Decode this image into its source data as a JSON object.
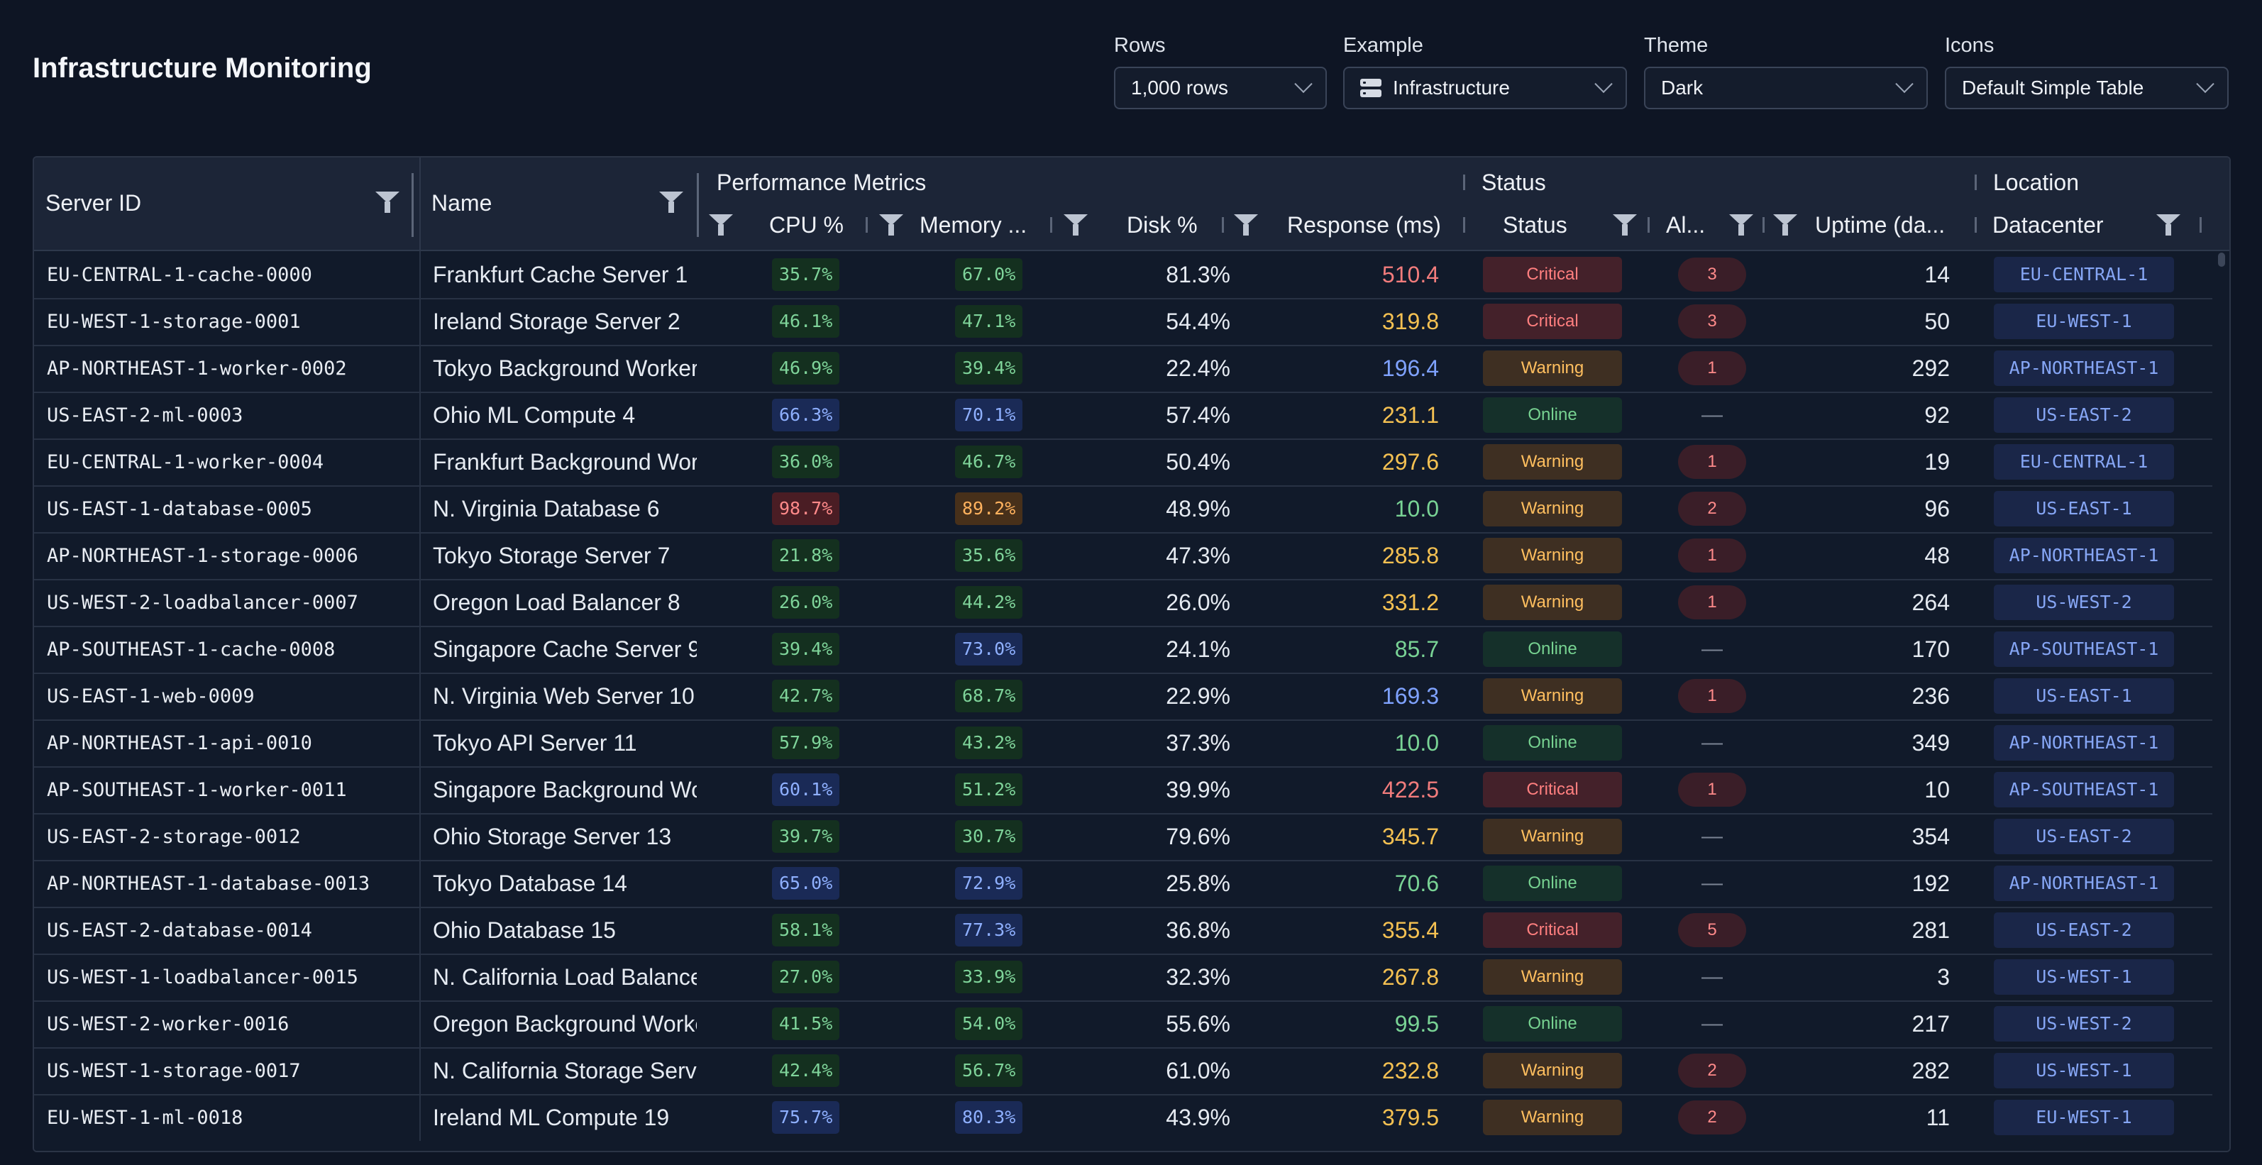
{
  "header": {
    "title": "Infrastructure Monitoring"
  },
  "controls": [
    {
      "label": "Rows",
      "value": "1,000 rows",
      "icon": null
    },
    {
      "label": "Example",
      "value": "Infrastructure",
      "icon": "server-icon"
    },
    {
      "label": "Theme",
      "value": "Dark",
      "icon": null
    },
    {
      "label": "Icons",
      "value": "Default Simple Table",
      "icon": null
    }
  ],
  "grid": {
    "groups": {
      "performance": "Performance Metrics",
      "status": "Status",
      "location": "Location"
    },
    "columns": {
      "server_id": "Server ID",
      "name": "Name",
      "cpu": "CPU %",
      "memory": "Memory ...",
      "disk": "Disk %",
      "response": "Response (ms)",
      "status": "Status",
      "alerts": "Al...",
      "uptime": "Uptime (da...",
      "datacenter": "Datacenter"
    },
    "rows": [
      {
        "id": "EU-CENTRAL-1-cache-0000",
        "name": "Frankfurt Cache Server 1",
        "cpu": "35.7%",
        "mem": "67.0%",
        "disk": "81.3%",
        "resp": "510.4",
        "status": "Critical",
        "alerts": "3",
        "uptime": "14",
        "dc": "EU-CENTRAL-1"
      },
      {
        "id": "EU-WEST-1-storage-0001",
        "name": "Ireland Storage Server 2",
        "cpu": "46.1%",
        "mem": "47.1%",
        "disk": "54.4%",
        "resp": "319.8",
        "status": "Critical",
        "alerts": "3",
        "uptime": "50",
        "dc": "EU-WEST-1"
      },
      {
        "id": "AP-NORTHEAST-1-worker-0002",
        "name": "Tokyo Background Worker",
        "cpu": "46.9%",
        "mem": "39.4%",
        "disk": "22.4%",
        "resp": "196.4",
        "status": "Warning",
        "alerts": "1",
        "uptime": "292",
        "dc": "AP-NORTHEAST-1"
      },
      {
        "id": "US-EAST-2-ml-0003",
        "name": "Ohio ML Compute 4",
        "cpu": "66.3%",
        "mem": "70.1%",
        "disk": "57.4%",
        "resp": "231.1",
        "status": "Online",
        "alerts": "—",
        "uptime": "92",
        "dc": "US-EAST-2"
      },
      {
        "id": "EU-CENTRAL-1-worker-0004",
        "name": "Frankfurt Background Wor",
        "cpu": "36.0%",
        "mem": "46.7%",
        "disk": "50.4%",
        "resp": "297.6",
        "status": "Warning",
        "alerts": "1",
        "uptime": "19",
        "dc": "EU-CENTRAL-1"
      },
      {
        "id": "US-EAST-1-database-0005",
        "name": "N. Virginia Database 6",
        "cpu": "98.7%",
        "mem": "89.2%",
        "disk": "48.9%",
        "resp": "10.0",
        "status": "Warning",
        "alerts": "2",
        "uptime": "96",
        "dc": "US-EAST-1"
      },
      {
        "id": "AP-NORTHEAST-1-storage-0006",
        "name": "Tokyo Storage Server 7",
        "cpu": "21.8%",
        "mem": "35.6%",
        "disk": "47.3%",
        "resp": "285.8",
        "status": "Warning",
        "alerts": "1",
        "uptime": "48",
        "dc": "AP-NORTHEAST-1"
      },
      {
        "id": "US-WEST-2-loadbalancer-0007",
        "name": "Oregon Load Balancer 8",
        "cpu": "26.0%",
        "mem": "44.2%",
        "disk": "26.0%",
        "resp": "331.2",
        "status": "Warning",
        "alerts": "1",
        "uptime": "264",
        "dc": "US-WEST-2"
      },
      {
        "id": "AP-SOUTHEAST-1-cache-0008",
        "name": "Singapore Cache Server 9",
        "cpu": "39.4%",
        "mem": "73.0%",
        "disk": "24.1%",
        "resp": "85.7",
        "status": "Online",
        "alerts": "—",
        "uptime": "170",
        "dc": "AP-SOUTHEAST-1"
      },
      {
        "id": "US-EAST-1-web-0009",
        "name": "N. Virginia Web Server 10",
        "cpu": "42.7%",
        "mem": "68.7%",
        "disk": "22.9%",
        "resp": "169.3",
        "status": "Warning",
        "alerts": "1",
        "uptime": "236",
        "dc": "US-EAST-1"
      },
      {
        "id": "AP-NORTHEAST-1-api-0010",
        "name": "Tokyo API Server 11",
        "cpu": "57.9%",
        "mem": "43.2%",
        "disk": "37.3%",
        "resp": "10.0",
        "status": "Online",
        "alerts": "—",
        "uptime": "349",
        "dc": "AP-NORTHEAST-1"
      },
      {
        "id": "AP-SOUTHEAST-1-worker-0011",
        "name": "Singapore Background Wo",
        "cpu": "60.1%",
        "mem": "51.2%",
        "disk": "39.9%",
        "resp": "422.5",
        "status": "Critical",
        "alerts": "1",
        "uptime": "10",
        "dc": "AP-SOUTHEAST-1"
      },
      {
        "id": "US-EAST-2-storage-0012",
        "name": "Ohio Storage Server 13",
        "cpu": "39.7%",
        "mem": "30.7%",
        "disk": "79.6%",
        "resp": "345.7",
        "status": "Warning",
        "alerts": "—",
        "uptime": "354",
        "dc": "US-EAST-2"
      },
      {
        "id": "AP-NORTHEAST-1-database-0013",
        "name": "Tokyo Database 14",
        "cpu": "65.0%",
        "mem": "72.9%",
        "disk": "25.8%",
        "resp": "70.6",
        "status": "Online",
        "alerts": "—",
        "uptime": "192",
        "dc": "AP-NORTHEAST-1"
      },
      {
        "id": "US-EAST-2-database-0014",
        "name": "Ohio Database 15",
        "cpu": "58.1%",
        "mem": "77.3%",
        "disk": "36.8%",
        "resp": "355.4",
        "status": "Critical",
        "alerts": "5",
        "uptime": "281",
        "dc": "US-EAST-2"
      },
      {
        "id": "US-WEST-1-loadbalancer-0015",
        "name": "N. California Load Balance",
        "cpu": "27.0%",
        "mem": "33.9%",
        "disk": "32.3%",
        "resp": "267.8",
        "status": "Warning",
        "alerts": "—",
        "uptime": "3",
        "dc": "US-WEST-1"
      },
      {
        "id": "US-WEST-2-worker-0016",
        "name": "Oregon Background Worke",
        "cpu": "41.5%",
        "mem": "54.0%",
        "disk": "55.6%",
        "resp": "99.5",
        "status": "Online",
        "alerts": "—",
        "uptime": "217",
        "dc": "US-WEST-2"
      },
      {
        "id": "US-WEST-1-storage-0017",
        "name": "N. California Storage Serve",
        "cpu": "42.4%",
        "mem": "56.7%",
        "disk": "61.0%",
        "resp": "232.8",
        "status": "Warning",
        "alerts": "2",
        "uptime": "282",
        "dc": "US-WEST-1"
      },
      {
        "id": "EU-WEST-1-ml-0018",
        "name": "Ireland ML Compute 19",
        "cpu": "75.7%",
        "mem": "80.3%",
        "disk": "43.9%",
        "resp": "379.5",
        "status": "Warning",
        "alerts": "2",
        "uptime": "11",
        "dc": "EU-WEST-1"
      }
    ]
  },
  "colors": {
    "background": "#0e1524",
    "header": "#1c2537",
    "critical": "#ff7f7f",
    "warning": "#ffbf5f",
    "online": "#77d291",
    "link_blue": "#86a6f5"
  }
}
